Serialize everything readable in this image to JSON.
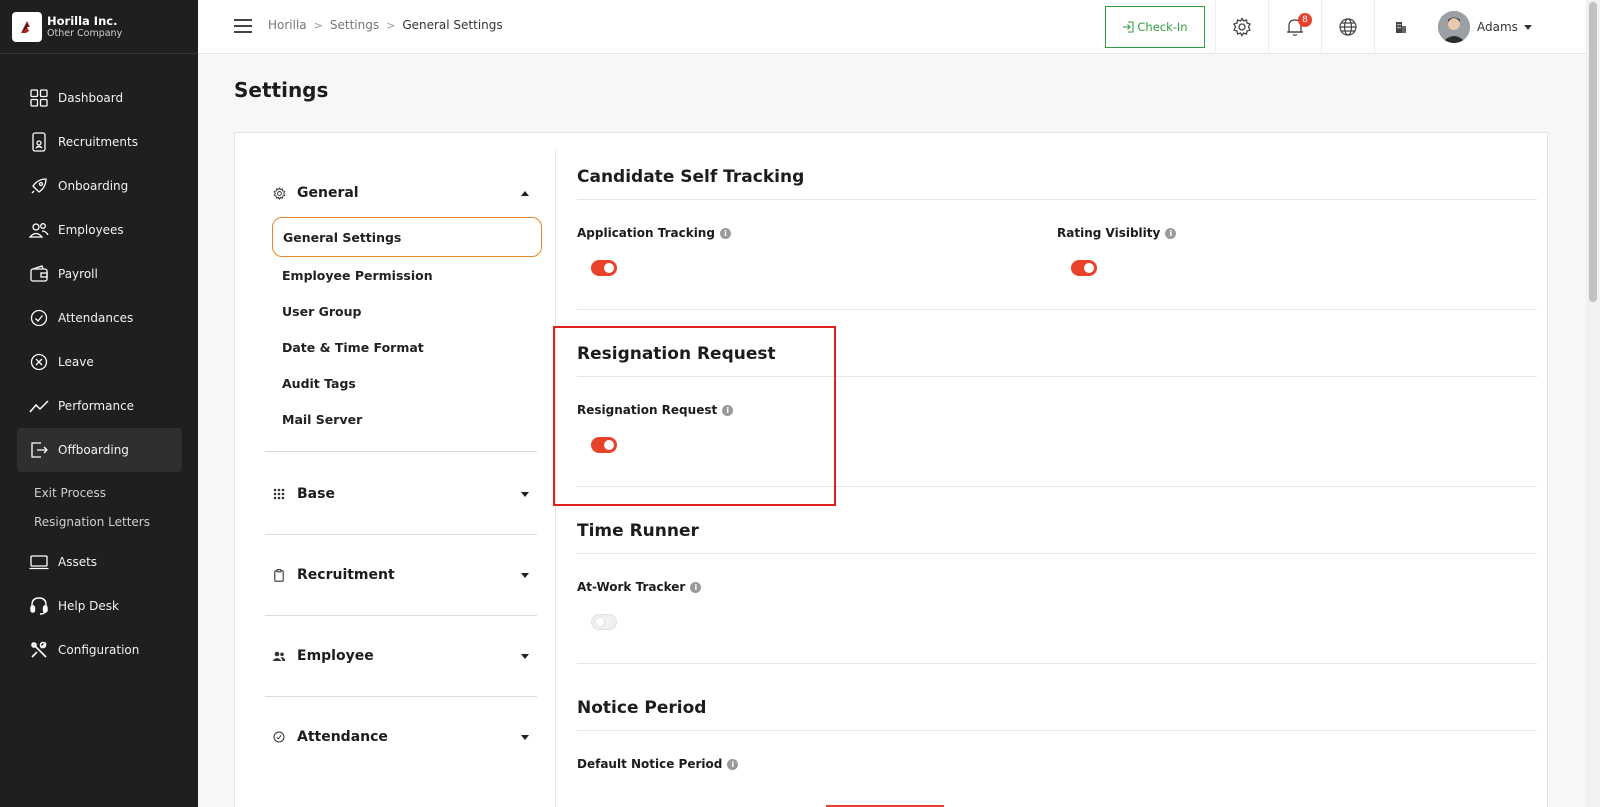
{
  "brand": {
    "name": "Horilla Inc.",
    "sub": "Other Company"
  },
  "sidebar": {
    "items": [
      {
        "label": "Dashboard",
        "icon": "dashboard-icon"
      },
      {
        "label": "Recruitments",
        "icon": "recruitment-icon"
      },
      {
        "label": "Onboarding",
        "icon": "rocket-icon"
      },
      {
        "label": "Employees",
        "icon": "people-icon"
      },
      {
        "label": "Payroll",
        "icon": "wallet-icon"
      },
      {
        "label": "Attendances",
        "icon": "check-circle-icon"
      },
      {
        "label": "Leave",
        "icon": "x-circle-icon"
      },
      {
        "label": "Performance",
        "icon": "trend-icon"
      },
      {
        "label": "Offboarding",
        "icon": "exit-icon"
      }
    ],
    "offboarding_sub": [
      "Exit Process",
      "Resignation Letters"
    ],
    "items_after": [
      {
        "label": "Assets",
        "icon": "laptop-icon"
      },
      {
        "label": "Help Desk",
        "icon": "headset-icon"
      },
      {
        "label": "Configuration",
        "icon": "tools-icon"
      }
    ]
  },
  "header": {
    "breadcrumb": [
      "Horilla",
      "Settings",
      "General Settings"
    ],
    "checkin_label": "Check-In",
    "notification_count": "8",
    "user_name": "Adams"
  },
  "page": {
    "title": "Settings"
  },
  "settings_menu": {
    "general": {
      "label": "General",
      "items": [
        "General Settings",
        "Employee Permission",
        "User Group",
        "Date & Time Format",
        "Audit Tags",
        "Mail Server"
      ],
      "active": "General Settings"
    },
    "groups": [
      "Base",
      "Recruitment",
      "Employee",
      "Attendance"
    ]
  },
  "sections": {
    "candidate": {
      "title": "Candidate Self Tracking",
      "fields": [
        {
          "label": "Application Tracking",
          "on": true
        },
        {
          "label": "Rating Visiblity",
          "on": true
        }
      ]
    },
    "resignation": {
      "title": "Resignation Request",
      "field_label": "Resignation Request",
      "on": true
    },
    "time_runner": {
      "title": "Time Runner",
      "field_label": "At-Work Tracker",
      "on": false
    },
    "notice": {
      "title": "Notice Period",
      "field_label": "Default Notice Period"
    }
  },
  "colors": {
    "accent": "#e8412c",
    "checkin": "#2ea043",
    "active_border": "#e8872c",
    "highlight": "#e02020"
  }
}
